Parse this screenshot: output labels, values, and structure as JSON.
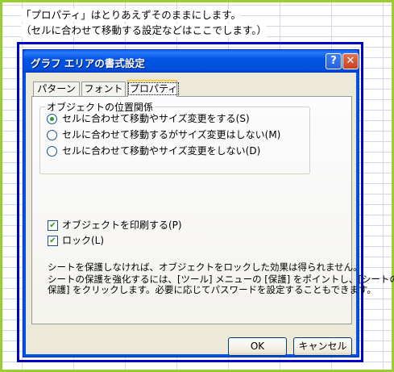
{
  "sheet_notes": {
    "line1": "「プロパティ」はとりあえずそのままにします。",
    "line2": "（セルに合わせて移動する設定などはここでします。）"
  },
  "dialog": {
    "title": "グラフ エリアの書式設定",
    "help_label": "?",
    "close_label": "✕",
    "tabs": [
      {
        "label": "パターン",
        "selected": false
      },
      {
        "label": "フォント",
        "selected": false
      },
      {
        "label": "プロパティ",
        "selected": true
      }
    ],
    "placement_group": {
      "title": "オブジェクトの位置関係",
      "options": [
        {
          "label": "セルに合わせて移動やサイズ変更をする(S)",
          "checked": true
        },
        {
          "label": "セルに合わせて移動するがサイズ変更はしない(M)",
          "checked": false
        },
        {
          "label": "セルに合わせて移動やサイズ変更をしない(D)",
          "checked": false
        }
      ]
    },
    "checkboxes": [
      {
        "label": "オブジェクトを印刷する(P)",
        "checked": true
      },
      {
        "label": "ロック(L)",
        "checked": true
      }
    ],
    "description": {
      "line1": "シートを保護しなければ、オブジェクトをロックした効果は得られません。",
      "line2": "シートの保護を強化するには、[ツール] メニューの [保護] をポイントし、[シートの",
      "line3": "保護] をクリックします。必要に応じてパスワードを設定することもできます。"
    },
    "ok_label": "OK",
    "cancel_label": "キャンセル"
  },
  "colors": {
    "frame_outer": "#9acd32",
    "chart_area_border": "#0000cc",
    "titlebar": "#0054e3",
    "dialog_bg": "#ece9d8"
  }
}
